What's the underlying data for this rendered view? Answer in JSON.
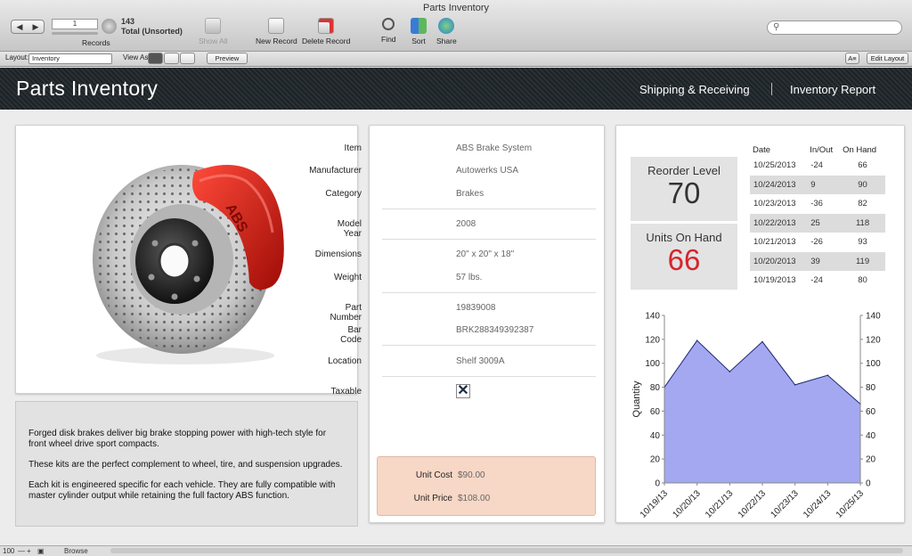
{
  "window": {
    "title": "Parts Inventory"
  },
  "toolbar": {
    "record_number": "1",
    "records_label": "Records",
    "record_count": "143",
    "sort_state": "Total (Unsorted)",
    "show_all": "Show All",
    "new_record": "New Record",
    "delete_record": "Delete Record",
    "find": "Find",
    "sort": "Sort",
    "share": "Share"
  },
  "layout_bar": {
    "layout_label": "Layout:",
    "layout_value": "Inventory",
    "view_as_label": "View As:",
    "preview": "Preview",
    "font_btn": "A≡",
    "edit_layout": "Edit Layout"
  },
  "header": {
    "title": "Parts Inventory",
    "links": [
      "Shipping & Receiving",
      "Inventory Report"
    ]
  },
  "description": [
    "Forged disk brakes deliver big brake stopping power with high-tech style for front wheel drive sport compacts.",
    "These kits are the perfect complement to wheel, tire, and suspension upgrades.",
    "Each kit is engineered specific for each vehicle. They are fully compatible with master cylinder output while retaining the full factory ABS function."
  ],
  "details": {
    "item": {
      "label": "Item",
      "value": "ABS Brake System"
    },
    "manufacturer": {
      "label": "Manufacturer",
      "value": "Autowerks USA"
    },
    "category": {
      "label": "Category",
      "value": "Brakes"
    },
    "model_year": {
      "label": "Model Year",
      "value": "2008"
    },
    "dimensions": {
      "label": "Dimensions",
      "value": "20\" x 20\" x 18\""
    },
    "weight": {
      "label": "Weight",
      "value": "57 lbs."
    },
    "part_number": {
      "label": "Part Number",
      "value": "19839008"
    },
    "bar_code": {
      "label": "Bar Code",
      "value": "BRK288349392387"
    },
    "location": {
      "label": "Location",
      "value": "Shelf 3009A"
    },
    "taxable": {
      "label": "Taxable",
      "checked": true,
      "mark": "✕"
    },
    "unit_cost": {
      "label": "Unit Cost",
      "value": "$90.00"
    },
    "unit_price": {
      "label": "Unit Price",
      "value": "$108.00"
    }
  },
  "stock": {
    "reorder_label": "Reorder Level",
    "reorder_value": "70",
    "onhand_label": "Units On Hand",
    "onhand_value": "66",
    "onhand_color": "#d8232a"
  },
  "history": {
    "headers": [
      "Date",
      "In/Out",
      "On Hand"
    ],
    "rows": [
      [
        "10/25/2013",
        "-24",
        "66"
      ],
      [
        "10/24/2013",
        "9",
        "90"
      ],
      [
        "10/23/2013",
        "-36",
        "82"
      ],
      [
        "10/22/2013",
        "25",
        "118"
      ],
      [
        "10/21/2013",
        "-26",
        "93"
      ],
      [
        "10/20/2013",
        "39",
        "119"
      ],
      [
        "10/19/2013",
        "-24",
        "80"
      ]
    ]
  },
  "chart_data": {
    "type": "area",
    "categories": [
      "10/19/13",
      "10/20/13",
      "10/21/13",
      "10/22/13",
      "10/23/13",
      "10/24/13",
      "10/25/13"
    ],
    "series": [
      {
        "values": [
          80,
          119,
          93,
          118,
          82,
          90,
          66
        ]
      }
    ],
    "ylabel": "Quantity",
    "ylim": [
      0,
      140
    ],
    "yticks": [
      0,
      20,
      40,
      60,
      80,
      100,
      120,
      140
    ],
    "fill_color": "#a3a8f0",
    "line_color": "#1e2870"
  },
  "status": {
    "zoom": "100",
    "mode": "Browse"
  }
}
